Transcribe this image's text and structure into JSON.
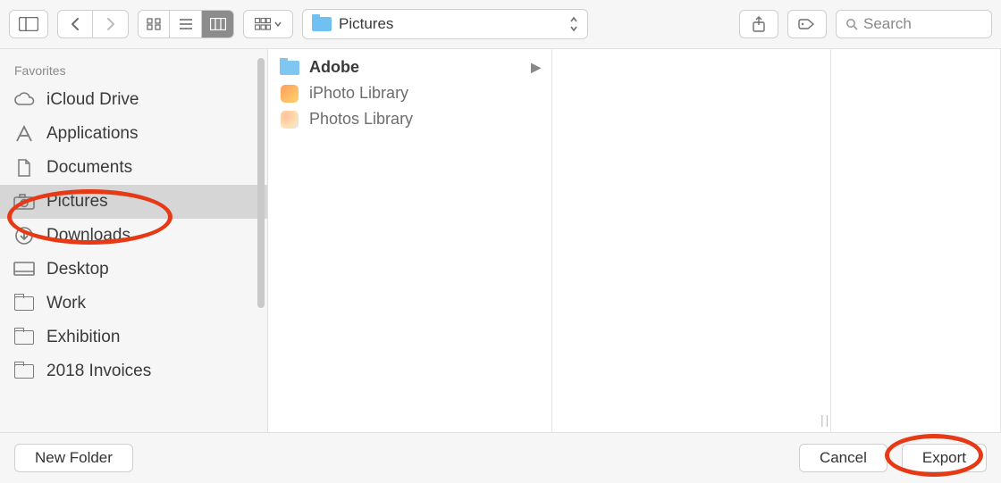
{
  "toolbar": {
    "path_label": "Pictures",
    "search_placeholder": "Search"
  },
  "sidebar": {
    "header": "Favorites",
    "items": [
      {
        "label": "iCloud Drive",
        "icon": "cloud-icon",
        "selected": false
      },
      {
        "label": "Applications",
        "icon": "app-a-icon",
        "selected": false
      },
      {
        "label": "Documents",
        "icon": "document-icon",
        "selected": false
      },
      {
        "label": "Pictures",
        "icon": "camera-icon",
        "selected": true
      },
      {
        "label": "Downloads",
        "icon": "download-icon",
        "selected": false
      },
      {
        "label": "Desktop",
        "icon": "desktop-icon",
        "selected": false
      },
      {
        "label": "Work",
        "icon": "folder-icon",
        "selected": false
      },
      {
        "label": "Exhibition",
        "icon": "folder-icon",
        "selected": false
      },
      {
        "label": "2018 Invoices",
        "icon": "folder-icon",
        "selected": false
      }
    ]
  },
  "column1": {
    "items": [
      {
        "label": "Adobe",
        "icon": "bluefolder",
        "selected": true,
        "has_children": true
      },
      {
        "label": "iPhoto Library",
        "icon": "appicon",
        "selected": false,
        "has_children": false
      },
      {
        "label": "Photos Library",
        "icon": "appicon2",
        "selected": false,
        "has_children": false
      }
    ]
  },
  "footer": {
    "new_folder": "New Folder",
    "cancel": "Cancel",
    "export": "Export"
  }
}
